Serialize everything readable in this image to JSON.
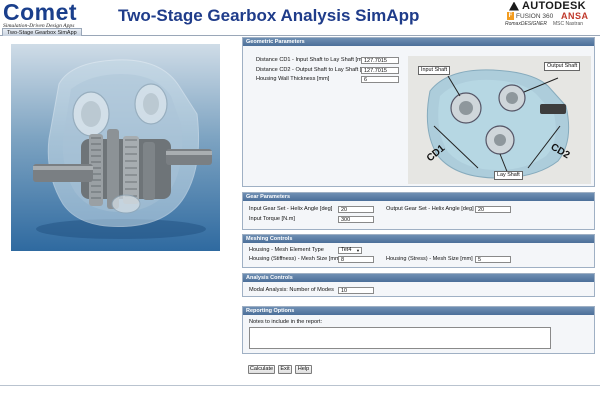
{
  "header": {
    "logo_word": "Comet",
    "logo_tagline": "Simulation-Driven Design Apps",
    "title": "Two-Stage Gearbox Analysis SimApp",
    "brand_autodesk": "AUTODESK",
    "brand_fusion": "FUSION 360",
    "brand_ramox": "RomaxDESIGNER",
    "brand_ansa": "ANSA",
    "brand_msc": "MSC Nastran"
  },
  "tabs": [
    {
      "label": "Two-Stage Gearbox SimApp"
    }
  ],
  "geometric": {
    "heading": "Geometric Parameters",
    "cd1_label": "Distance CD1 - Input Shaft to Lay Shaft [mm]",
    "cd1_value": "127.7015",
    "cd2_label": "Distance CD2 - Output Shaft to Lay Shaft [mm]",
    "cd2_value": "127.7015",
    "wall_label": "Housing Wall Thickness [mm]",
    "wall_value": "6",
    "photo_labels": {
      "input_shaft": "Input Shaft",
      "output_shaft": "Output Shaft",
      "lay_shaft": "Lay Shaft",
      "cd1": "CD1",
      "cd2": "CD2"
    }
  },
  "gear": {
    "heading": "Gear Parameters",
    "input_helix_label": "Input Gear Set - Helix Angle [deg]",
    "input_helix_value": "20",
    "output_helix_label": "Output Gear Set - Helix Angle [deg]",
    "output_helix_value": "20",
    "torque_label": "Input Torque [N.m]",
    "torque_value": "300"
  },
  "meshing": {
    "heading": "Meshing Controls",
    "element_type_label": "Housing - Mesh Element Type",
    "element_type_value": "Tet4",
    "stiffness_size_label": "Housing (Stiffness) - Mesh Size [mm]",
    "stiffness_size_value": "8",
    "stress_size_label": "Housing (Stress) - Mesh Size [mm]",
    "stress_size_value": "5"
  },
  "analysis": {
    "heading": "Analysis Controls",
    "modes_label": "Modal Analysis: Number of Modes",
    "modes_value": "10"
  },
  "reporting": {
    "heading": "Reporting Options",
    "notes_label": "Notes to include in the report:",
    "notes_value": ""
  },
  "buttons": {
    "calculate": "Calculate",
    "exit": "Exit",
    "help": "Help"
  },
  "colors": {
    "title_blue": "#1f3c8a",
    "panel_header": "#5a7ba5",
    "viewport_top": "#cfdce7",
    "viewport_bottom": "#2f6aa0"
  }
}
